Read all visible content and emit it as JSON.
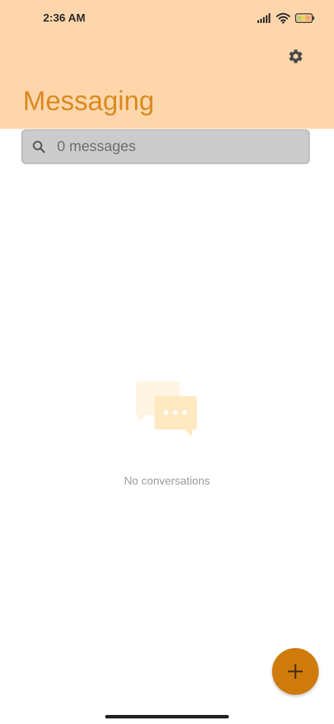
{
  "status_bar": {
    "time": "2:36 AM",
    "icons": [
      "signal-icon",
      "wifi-icon",
      "battery-icon"
    ]
  },
  "header": {
    "title": "Messaging",
    "settings_icon": "gear-icon",
    "background_color": "#ffd6ab",
    "title_color": "#d98a20"
  },
  "search": {
    "icon": "search-icon",
    "text": "0 messages"
  },
  "empty_state": {
    "icon": "chat-bubbles-icon",
    "text": "No conversations"
  },
  "fab": {
    "icon": "plus-icon",
    "color": "#d07a0b"
  }
}
